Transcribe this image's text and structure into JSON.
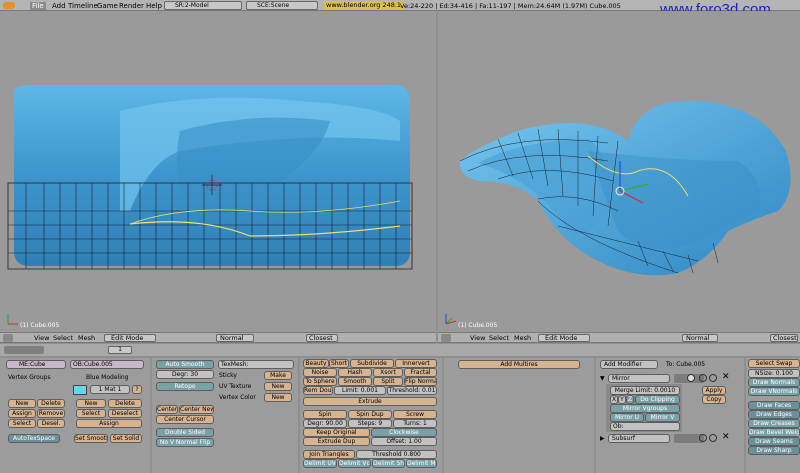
{
  "topbar": {
    "menus": [
      "File",
      "Add",
      "Timeline",
      "Game",
      "Render",
      "Help"
    ],
    "screen": "SR:2-Model",
    "scene": "SCE:Scene",
    "url": "www.blender.org 248.1",
    "stats": "Ve:24-220 | Ed:34-416 | Fa:11-197 | Mem:24.64M (1.97M) Cube.005",
    "watermark": "www.foro3d.com"
  },
  "viewports": [
    {
      "label": "(1) Cube.005",
      "menus": [
        "View",
        "Select",
        "Mesh"
      ],
      "mode": "Edit Mode",
      "pivot": "Normal",
      "snap": "Closest"
    },
    {
      "label": "(1) Cube.005",
      "menus": [
        "View",
        "Select",
        "Mesh"
      ],
      "mode": "Edit Mode",
      "pivot": "Normal",
      "snap": "Closest"
    }
  ],
  "buttons_header": {
    "frame": "1"
  },
  "link_panel": {
    "mesh": "ME:Cube",
    "object": "OB:Cube.005",
    "vertex_groups": "Vertex Groups",
    "blue_modeling": "Blue Modeling",
    "mat": "1 Mat 1",
    "question": "?",
    "left_buttons": [
      "New",
      "Delete",
      "Assign",
      "Remove",
      "Select",
      "Desel."
    ],
    "mid_buttons": [
      "New",
      "Delete",
      "Select",
      "Deselect",
      "Assign"
    ],
    "autotex": "AutoTexSpace",
    "set_smooth": "Set Smooth",
    "set_solid": "Set Solid"
  },
  "mesh_panel": {
    "auto_smooth": "Auto Smooth",
    "degr": "Degr: 30",
    "retopo": "Retopo",
    "center": "Center",
    "center_new": "Center New",
    "center_cursor": "Center Cursor",
    "double_sided": "Double Sided",
    "no_v_normal_flip": "No V Normal Flip",
    "texmesh": "TexMesh:",
    "sticky": "Sticky",
    "make": "Make",
    "uv_texture": "UV Texture",
    "vertex_color": "Vertex Color",
    "new1": "New",
    "new2": "New"
  },
  "tools": {
    "row1": [
      "Beauty",
      "Short",
      "Subdivide",
      "Innervert"
    ],
    "row2": [
      "Noise",
      "Hash",
      "Xsort",
      "Fractal"
    ],
    "row3": [
      "To Sphere",
      "Smooth",
      "Split",
      "Flip Normal"
    ],
    "row4": [
      "Rem Doubl",
      "Limit: 0.001",
      "Threshold: 0.01"
    ],
    "extrude": "Extrude",
    "row5": [
      "Spin",
      "Spin Dup",
      "Screw"
    ],
    "row6": [
      "Degr: 90.00",
      "Steps: 9",
      "Turns: 1"
    ],
    "keep_original": "Keep Original",
    "clockwise": "Clockwise",
    "extrude_dup": "Extrude Dup",
    "offset": "Offset: 1.00",
    "join_triangles": "Join Triangles",
    "threshold": "Threshold 0.800",
    "delimit": [
      "Delimit UVs",
      "Delimit Vcol",
      "Delimit Shar",
      "Delimit Mat"
    ]
  },
  "multires": {
    "add": "Add Multires"
  },
  "modifiers": {
    "add_modifier": "Add Modifier",
    "to": "To: Cube.005",
    "mirror": "Mirror",
    "merge_limit": "Merge Limit: 0.0010",
    "axes": [
      "X",
      "Y",
      "Z"
    ],
    "do_clipping": "Do Clipping",
    "mirror_vgroups": "Mirror Vgroups",
    "mirror_u": "Mirror U",
    "mirror_v": "Mirror V",
    "ob": "Ob:",
    "apply": "Apply",
    "copy": "Copy",
    "subsurf": "Subsurf"
  },
  "mesh_tools_more": {
    "select_swap": "Select Swap",
    "nsize": "NSize: 0.100",
    "draw_normals": "Draw Normals",
    "draw_vnormals": "Draw VNormals",
    "draw_faces": "Draw Faces",
    "draw_edges": "Draw Edges",
    "draw_creases": "Draw Creases",
    "draw_bevel": "Draw Bevel Weig",
    "draw_seams": "Draw Seams",
    "draw_sharp": "Draw Sharp"
  },
  "colors": {
    "mesh_blue": "#4fa6d8",
    "salmon": "#d7b48f",
    "teal": "#7aa0a8",
    "cyan": "#76bcc7"
  }
}
